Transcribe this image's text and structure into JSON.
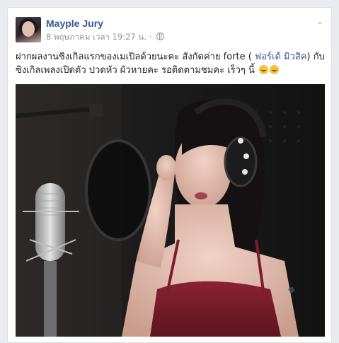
{
  "post": {
    "author": "Mayple Jury",
    "date": "8 พฤษภาคม เวลา 19:27 น.",
    "separator": "·",
    "text_part1": "ฝากผลงานซิงเกิลแรกของเมเปิลด้วยนะคะ สังกัดค่าย forte ( ",
    "text_link": "ฟอร์เต้ มิวสิค",
    "text_part2": ") กับซิงเกิลเพลงเปิดตัว ปวดหัว ผัวหายคะ รอติดตามชมคะ เร็วๆ นี้ "
  },
  "icons": {
    "privacy": "globe-icon",
    "menu": "chevron-down-icon",
    "emoji": "grinning-emoji-icon"
  },
  "colors": {
    "author": "#365899",
    "text": "#1d2129",
    "meta": "#90949c",
    "background": "#e9ebee"
  }
}
